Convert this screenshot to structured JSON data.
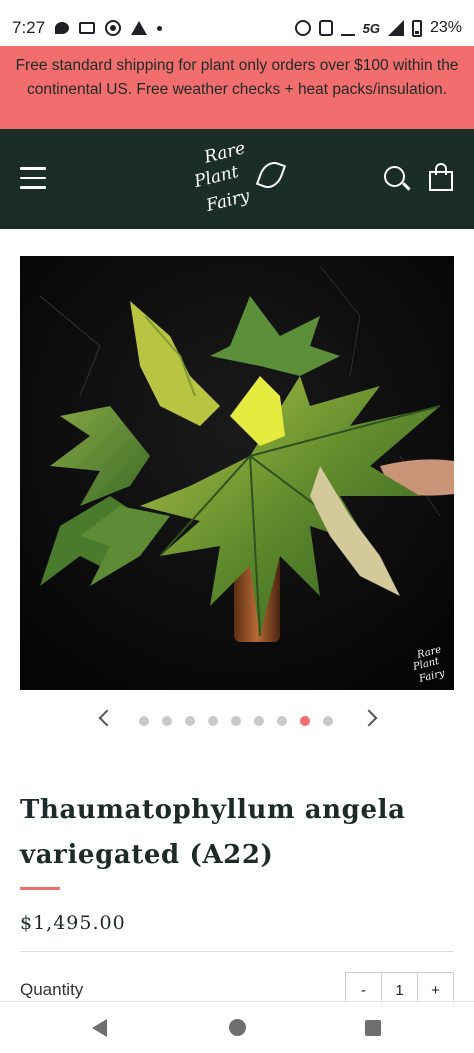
{
  "status_bar": {
    "time": "7:27",
    "network": "5G",
    "battery": "23%",
    "icons_left": [
      "chat-icon",
      "card-icon",
      "target-icon",
      "warning-icon",
      "dot-icon"
    ],
    "icons_right": [
      "alarm-icon",
      "nfc-icon",
      "mute-icon",
      "5g-icon",
      "signal-icon",
      "battery-icon"
    ]
  },
  "announcement": {
    "text": "Free standard shipping for plant only orders over $100 within the continental US. Free weather checks + heat packs/insulation."
  },
  "header": {
    "logo_lines": [
      "Rare",
      "Plant",
      "Fairy"
    ],
    "menu_icon": "hamburger-menu-icon",
    "search_icon": "search-icon",
    "cart_icon": "shopping-bag-icon",
    "background_color": "#1b2d29"
  },
  "product": {
    "image_watermark_lines": [
      "Rare",
      "Plant",
      "Fairy"
    ],
    "carousel": {
      "total_slides": 9,
      "active_index": 7
    },
    "title": "Thaumatophyllum angela variegated (A22)",
    "price": "$1,495.00",
    "quantity_label": "Quantity",
    "quantity": {
      "minus": "-",
      "value": "1",
      "plus": "+"
    }
  },
  "colors": {
    "accent": "#f26d6d",
    "header": "#1b2d29",
    "text": "#1c2b27"
  },
  "nav_bar": {
    "icons": [
      "back-icon",
      "home-icon",
      "recent-apps-icon"
    ]
  }
}
